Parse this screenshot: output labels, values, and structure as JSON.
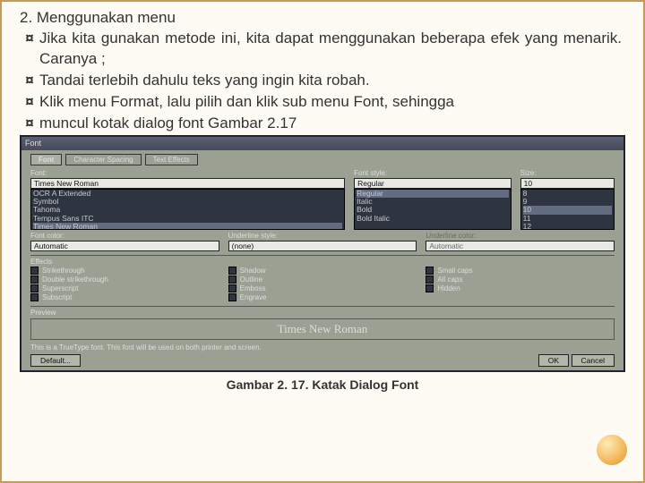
{
  "heading": "2. Menggunakan menu",
  "bullets": [
    "Jika kita gunakan metode ini, kita dapat menggunakan beberapa efek yang menarik. Caranya ;",
    "Tandai terlebih dahulu teks yang ingin kita robah.",
    "Klik menu Format, lalu pilih dan klik sub menu Font, sehingga",
    "muncul kotak dialog font  Gambar 2.17"
  ],
  "dialog": {
    "title": "Font",
    "tabs": [
      "Font",
      "Character Spacing",
      "Text Effects"
    ],
    "font": {
      "label": "Font:",
      "value": "Times New Roman",
      "options": [
        "OCR A Extended",
        "Symbol",
        "Tahoma",
        "Tempus Sans ITC",
        "Times New Roman"
      ]
    },
    "style": {
      "label": "Font style:",
      "value": "Regular",
      "options": [
        "Regular",
        "Italic",
        "Bold",
        "Bold Italic"
      ]
    },
    "size": {
      "label": "Size:",
      "value": "10",
      "options": [
        "8",
        "9",
        "10",
        "11",
        "12"
      ]
    },
    "color": {
      "label": "Font color:",
      "value": "Automatic"
    },
    "underline": {
      "label": "Underline style:",
      "value": "(none)"
    },
    "ucolor": {
      "label": "Underline color:",
      "value": "Automatic"
    },
    "effectsLabel": "Effects",
    "effects": {
      "c1": [
        "Strikethrough",
        "Double strikethrough",
        "Superscript",
        "Subscript"
      ],
      "c2": [
        "Shadow",
        "Outline",
        "Emboss",
        "Engrave"
      ],
      "c3": [
        "Small caps",
        "All caps",
        "Hidden"
      ]
    },
    "previewLabel": "Preview",
    "previewText": "Times New Roman",
    "note": "This is a TrueType font. This font will be used on both printer and screen.",
    "buttons": {
      "default": "Default...",
      "ok": "OK",
      "cancel": "Cancel"
    }
  },
  "caption": "Gambar 2. 17. Katak Dialog Font"
}
